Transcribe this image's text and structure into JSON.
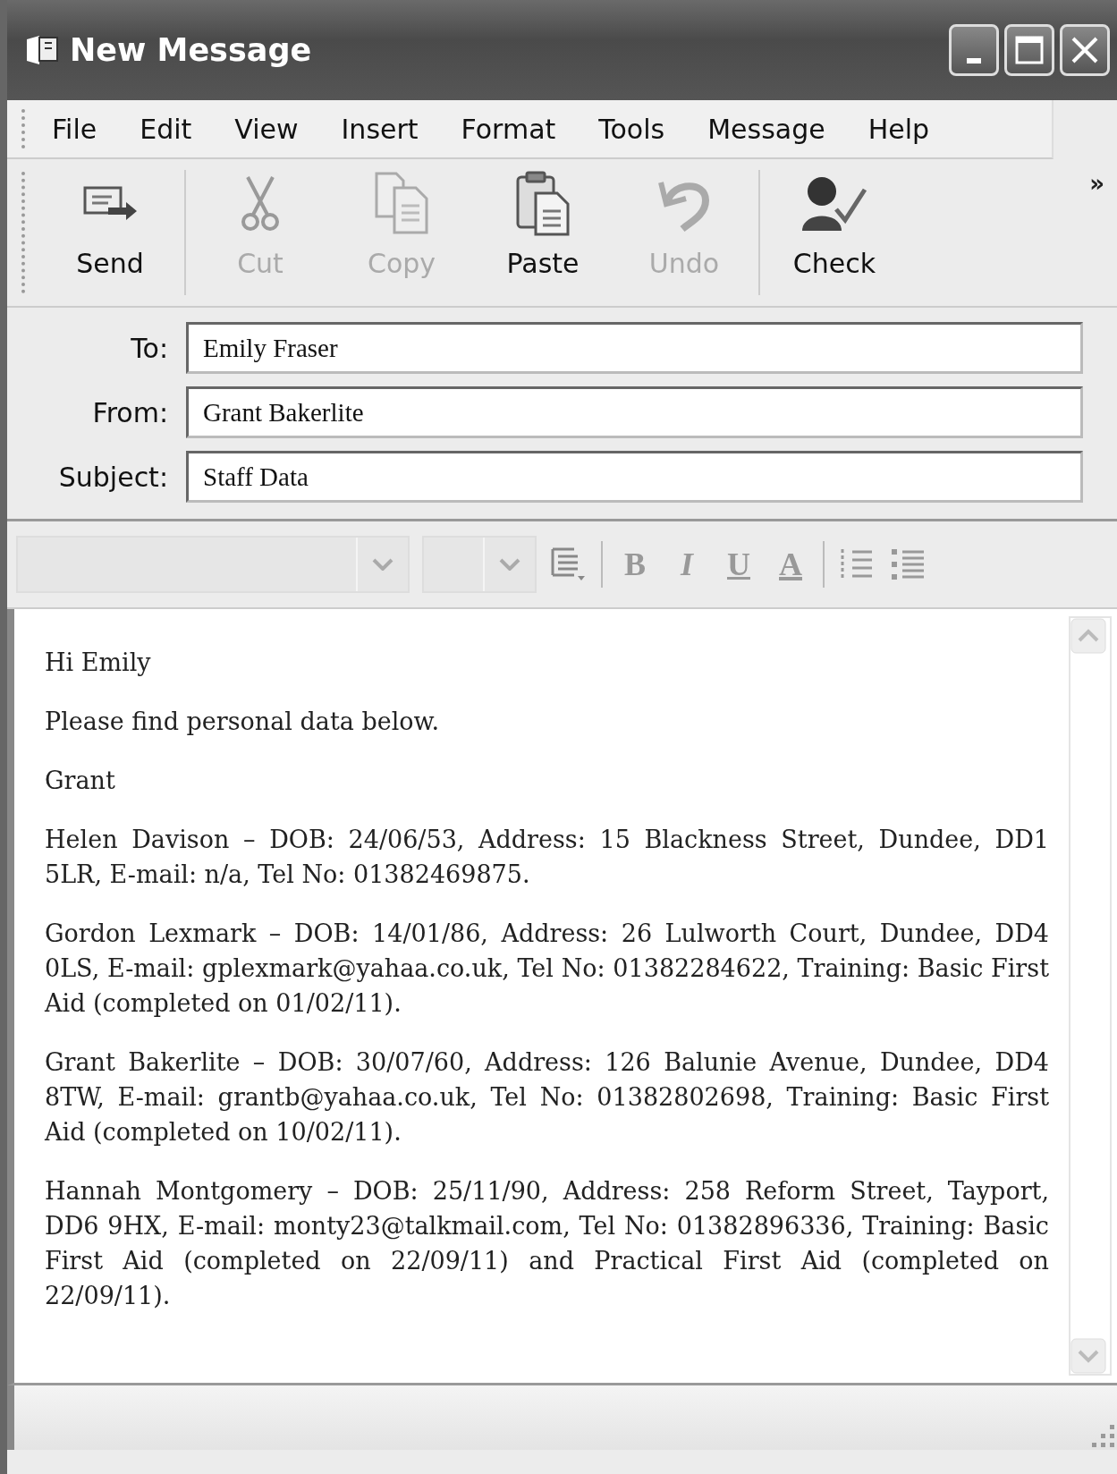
{
  "window": {
    "title": "New Message"
  },
  "menu": [
    "File",
    "Edit",
    "View",
    "Insert",
    "Format",
    "Tools",
    "Message",
    "Help"
  ],
  "toolbar": {
    "overflow": "»",
    "buttons": [
      {
        "kind": "send",
        "label": "Send",
        "disabled": false
      },
      {
        "kind": "cut",
        "label": "Cut",
        "disabled": true
      },
      {
        "kind": "copy",
        "label": "Copy",
        "disabled": true
      },
      {
        "kind": "paste",
        "label": "Paste",
        "disabled": false
      },
      {
        "kind": "undo",
        "label": "Undo",
        "disabled": true
      },
      {
        "kind": "check",
        "label": "Check",
        "disabled": false
      }
    ]
  },
  "fields": [
    {
      "label": "To:",
      "value": "Emily Fraser"
    },
    {
      "label": "From:",
      "value": "Grant Bakerlite"
    },
    {
      "label": "Subject:",
      "value": "Staff Data"
    }
  ],
  "format_bar": {
    "disabled": true,
    "buttons": [
      {
        "kind": "align"
      },
      {
        "kind": "bold",
        "label": "B"
      },
      {
        "kind": "italic",
        "label": "I"
      },
      {
        "kind": "underline",
        "label": "U"
      },
      {
        "kind": "color",
        "label": "A"
      },
      {
        "kind": "numbered"
      },
      {
        "kind": "bullets"
      }
    ]
  },
  "body": {
    "paragraphs": [
      "Hi Emily",
      "Please find personal data below.",
      "Grant",
      "Helen Davison – DOB: 24/06/53, Address: 15 Blackness Street, Dundee, DD1 5LR, E-mail: n/a, Tel No: 01382469875.",
      "Gordon Lexmark – DOB: 14/01/86, Address: 26 Lulworth Court, Dundee, DD4 0LS, E-mail: gplexmark@yahaa.co.uk, Tel No: 01382284622, Training: Basic First Aid (completed on 01/02/11).",
      "Grant Bakerlite – DOB: 30/07/60, Address: 126 Balunie Avenue, Dundee, DD4 8TW, E-mail: grantb@yahaa.co.uk, Tel No: 01382802698, Training: Basic First Aid (completed on 10/02/11).",
      "Hannah Montgomery – DOB: 25/11/90, Address: 258 Reform Street, Tayport, DD6 9HX, E-mail: monty23@talkmail.com, Tel No: 01382896336, Training: Basic First Aid (completed on 22/09/11) and Practical First Aid (completed on 22/09/11)."
    ]
  }
}
